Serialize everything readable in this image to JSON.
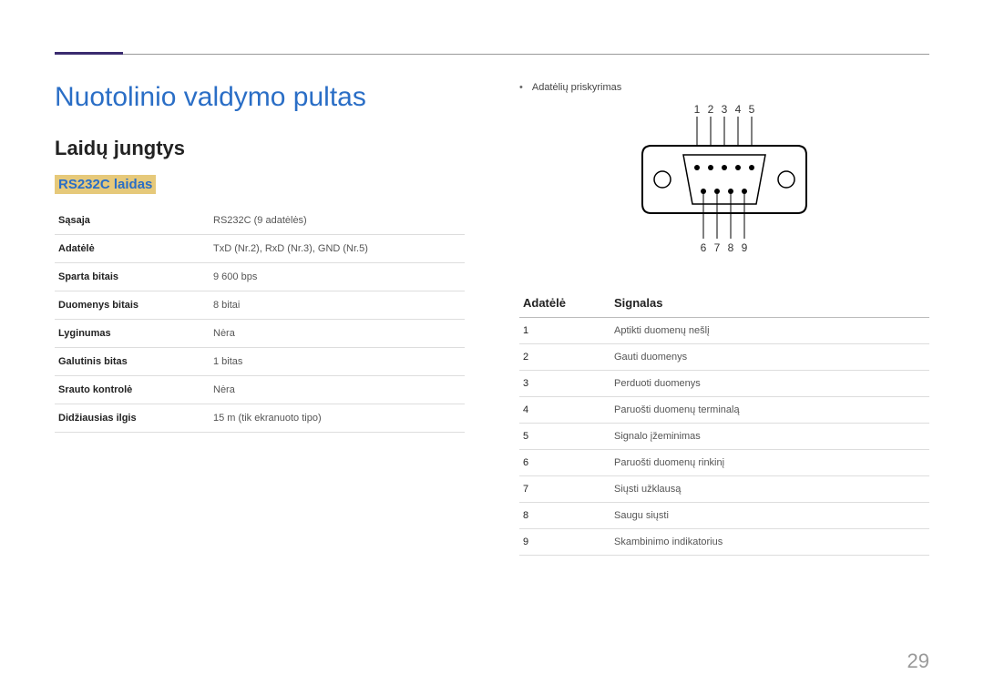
{
  "title_main": "Nuotolinio valdymo pultas",
  "title_sub": "Laidų jungtys",
  "title_section": "RS232C laidas",
  "specs": [
    {
      "label": "Sąsaja",
      "value": "RS232C (9 adatėlės)"
    },
    {
      "label": "Adatėlė",
      "value": "TxD (Nr.2), RxD (Nr.3), GND (Nr.5)"
    },
    {
      "label": "Sparta bitais",
      "value": "9 600 bps"
    },
    {
      "label": "Duomenys bitais",
      "value": "8 bitai"
    },
    {
      "label": "Lyginumas",
      "value": "Nėra"
    },
    {
      "label": "Galutinis bitas",
      "value": "1 bitas"
    },
    {
      "label": "Srauto kontrolė",
      "value": "Nėra"
    },
    {
      "label": "Didžiausias ilgis",
      "value": "15 m (tik ekranuoto tipo)"
    }
  ],
  "assignment_label": "Adatėlių priskyrimas",
  "diagram": {
    "top_numbers": [
      "1",
      "2",
      "3",
      "4",
      "5"
    ],
    "bottom_numbers": [
      "6",
      "7",
      "8",
      "9"
    ]
  },
  "pin_header": {
    "col1": "Adatėlė",
    "col2": "Signalas"
  },
  "pins": [
    {
      "n": "1",
      "sig": "Aptikti duomenų nešlį"
    },
    {
      "n": "2",
      "sig": "Gauti duomenys"
    },
    {
      "n": "3",
      "sig": "Perduoti duomenys"
    },
    {
      "n": "4",
      "sig": "Paruošti duomenų terminalą"
    },
    {
      "n": "5",
      "sig": "Signalo įžeminimas"
    },
    {
      "n": "6",
      "sig": "Paruošti duomenų rinkinį"
    },
    {
      "n": "7",
      "sig": "Siųsti užklausą"
    },
    {
      "n": "8",
      "sig": "Saugu siųsti"
    },
    {
      "n": "9",
      "sig": "Skambinimo indikatorius"
    }
  ],
  "page_number": "29"
}
